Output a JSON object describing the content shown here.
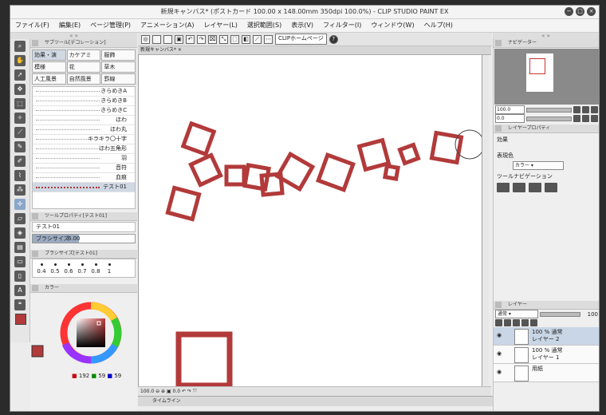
{
  "window": {
    "title": "新規キャンバス* (ポストカード 100.00 x 148.00mm 350dpi 100.0%) - CLIP STUDIO PAINT EX",
    "controls": [
      "−",
      "□",
      "×"
    ]
  },
  "menu": [
    "ファイル(F)",
    "編集(E)",
    "ページ管理(P)",
    "アニメーション(A)",
    "レイヤー(L)",
    "選択範囲(S)",
    "表示(V)",
    "フィルター(I)",
    "ウィンドウ(W)",
    "ヘルプ(H)"
  ],
  "command_bar": {
    "homepage_button": "CLIPホームページ",
    "help_icon": "?"
  },
  "left_panel": {
    "subtool_title": "サブツール[デコレーション]",
    "subtool_tabs": [
      "効果・演",
      "カケアミ",
      "服飾",
      "模様",
      "花",
      "草木",
      "人工風景",
      "自然風景",
      "罫線"
    ],
    "brushes": [
      "きらめきA",
      "きらめきB",
      "きらめきC",
      "ほわ",
      "ほわ丸",
      "キラキラ〇十字",
      "ほわ五角形",
      "羽",
      "音符",
      "血痕",
      "テスト01"
    ],
    "tool_property_title": "ツールプロパティ[テスト01]",
    "current_brush": "テスト01",
    "brush_size_label": "ブラシサイズ",
    "brush_size_value": "6.00",
    "brush_size_fraction": 0.45,
    "brush_size_panel_title": "ブラシサイズ[テスト01]",
    "size_presets": [
      "0.4",
      "0.5",
      "0.6",
      "0.7",
      "0.8",
      "1"
    ],
    "color_tab": "カラー",
    "color_values": {
      "r": "192",
      "g": "59",
      "b": "59"
    }
  },
  "canvas": {
    "doc_tab": "新規キャンバス*",
    "zoom": "100.0",
    "rotation": "0.0",
    "stroke_color": "#b23a3a",
    "timeline_label": "タイムライン"
  },
  "right_panel": {
    "navigator_tab": "ナビゲーター",
    "nav_zoom": "100.0",
    "nav_rotation": "0.0",
    "layer_property_tab": "レイヤープロパティ",
    "effect_label": "効果",
    "display_color_label": "表現色",
    "display_color_value": "カラー",
    "tool_nav_label": "ツールナビゲーション",
    "layer_tab": "レイヤー",
    "blend_mode": "通常",
    "opacity": "100",
    "layers": [
      {
        "line1": "100 % 通常",
        "line2": "レイヤー 2",
        "selected": true
      },
      {
        "line1": "100 % 通常",
        "line2": "レイヤー 1",
        "selected": false
      },
      {
        "line1": "",
        "line2": "用紙",
        "selected": false
      }
    ]
  },
  "accent_colors": {
    "brush_red": "#b23a3a",
    "selection_blue": "#c9d6e6"
  }
}
